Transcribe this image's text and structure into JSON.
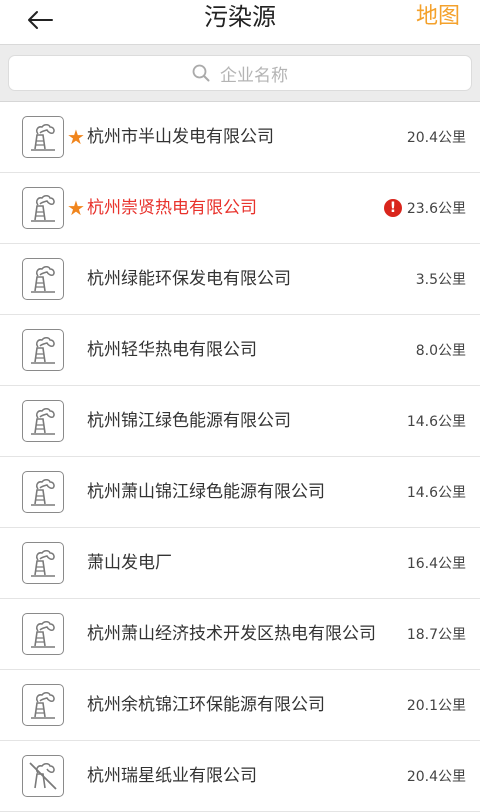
{
  "header": {
    "title": "污染源",
    "right_action": "地图"
  },
  "search": {
    "placeholder": "企业名称"
  },
  "colors": {
    "accent": "#f4a12b",
    "star": "#f0851d",
    "alert": "#e8322c"
  },
  "companies": [
    {
      "name": "杭州市半山发电有限公司",
      "distance": "20.4公里",
      "starred": true,
      "alert": false,
      "icon": "factory-smoke-icon"
    },
    {
      "name": "杭州崇贤热电有限公司",
      "distance": "23.6公里",
      "starred": true,
      "alert": true,
      "icon": "factory-smoke-icon"
    },
    {
      "name": "杭州绿能环保发电有限公司",
      "distance": "3.5公里",
      "starred": false,
      "alert": false,
      "icon": "factory-smoke-icon"
    },
    {
      "name": "杭州轻华热电有限公司",
      "distance": "8.0公里",
      "starred": false,
      "alert": false,
      "icon": "factory-smoke-icon"
    },
    {
      "name": "杭州锦江绿色能源有限公司",
      "distance": "14.6公里",
      "starred": false,
      "alert": false,
      "icon": "factory-smoke-icon"
    },
    {
      "name": "杭州萧山锦江绿色能源有限公司",
      "distance": "14.6公里",
      "starred": false,
      "alert": false,
      "icon": "factory-smoke-icon"
    },
    {
      "name": "萧山发电厂",
      "distance": "16.4公里",
      "starred": false,
      "alert": false,
      "icon": "factory-smoke-icon"
    },
    {
      "name": "杭州萧山经济技术开发区热电有限公司",
      "distance": "18.7公里",
      "starred": false,
      "alert": false,
      "icon": "factory-smoke-icon"
    },
    {
      "name": "杭州余杭锦江环保能源有限公司",
      "distance": "20.1公里",
      "starred": false,
      "alert": false,
      "icon": "factory-smoke-icon"
    },
    {
      "name": "杭州瑞星纸业有限公司",
      "distance": "20.4公里",
      "starred": false,
      "alert": false,
      "icon": "factory-disabled-icon"
    }
  ]
}
